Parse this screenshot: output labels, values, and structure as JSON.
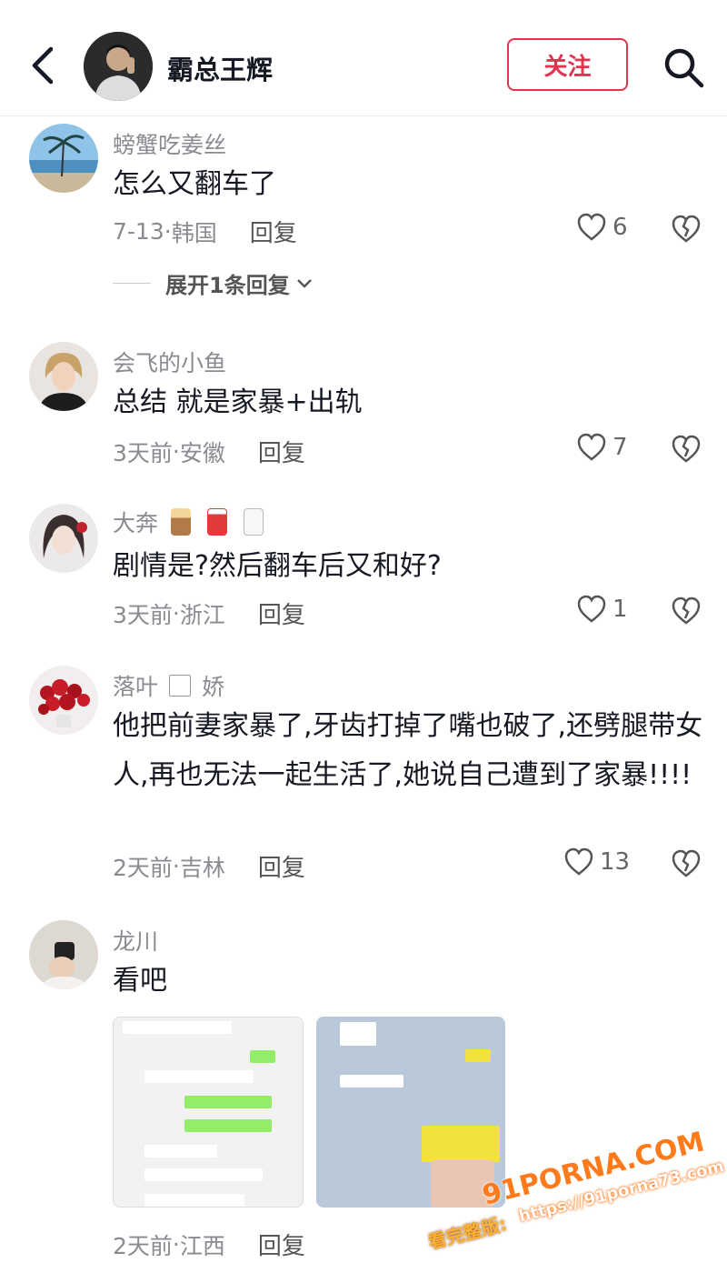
{
  "header": {
    "title": "霸总王辉",
    "follow_label": "关注"
  },
  "comments": [
    {
      "username": "螃蟹吃姜丝",
      "text": "怎么又翻车了",
      "time": "7-13",
      "location": "韩国",
      "reply_label": "回复",
      "likes": "6",
      "expand_label": "展开1条回复"
    },
    {
      "username": "会飞的小鱼",
      "text": "总结 就是家暴+出轨",
      "time": "3天前",
      "location": "安徽",
      "reply_label": "回复",
      "likes": "7"
    },
    {
      "username": "大奔",
      "text": "剧情是?然后翻车后又和好?",
      "time": "3天前",
      "location": "浙江",
      "reply_label": "回复",
      "likes": "1"
    },
    {
      "username_part1": "落叶",
      "username_part2": "娇",
      "text": "他把前妻家暴了,牙齿打掉了嘴也破了,还劈腿带女人,再也无法一起生活了,她说自己遭到了家暴!!!!",
      "time": "2天前",
      "location": "吉林",
      "reply_label": "回复",
      "likes": "13"
    },
    {
      "username": "龙川",
      "text": "看吧",
      "time": "2天前",
      "location": "江西",
      "reply_label": "回复"
    }
  ],
  "watermark": {
    "site": "91PORNA.COM",
    "url": "https://91porna73.com",
    "tag": "看完整版:"
  },
  "colors": {
    "accent": "#e2344f",
    "muted": "#8a8b91",
    "text": "#161823"
  }
}
